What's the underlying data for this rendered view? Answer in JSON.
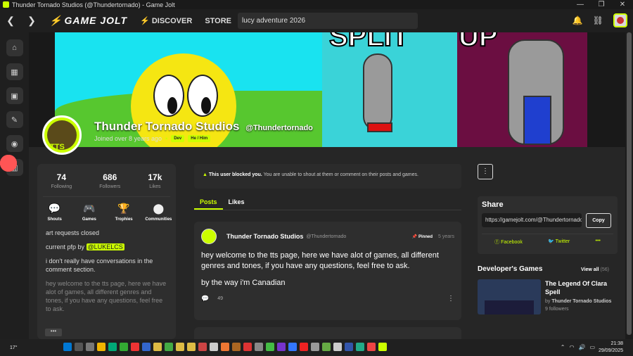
{
  "window": {
    "title": "Thunder Tornado Studios (@Thundertornado) - Game Jolt",
    "controls": [
      "—",
      "❐",
      "✕"
    ]
  },
  "navbar": {
    "back": "❮",
    "forward": "❯",
    "logo": "GAME JOLT",
    "discover": "DISCOVER",
    "store": "STORE",
    "more": "⋮",
    "search_value": "lucy adventure 2026"
  },
  "profile": {
    "name": "Thunder Tornado Studios",
    "handle": "@Thundertornado",
    "joined": "Joined over 8 years ago",
    "tag_dev": "Dev",
    "tag_pronouns": "He / Him",
    "avatar_text": "TTS",
    "stats": [
      {
        "value": "74",
        "label": "Following"
      },
      {
        "value": "686",
        "label": "Followers"
      },
      {
        "value": "17k",
        "label": "Likes"
      }
    ],
    "actions": [
      {
        "label": "Shouts",
        "icon": "💬"
      },
      {
        "label": "Games",
        "icon": "🎮"
      },
      {
        "label": "Trophies",
        "icon": "🏆"
      },
      {
        "label": "Communities",
        "icon": "⬤"
      }
    ],
    "bio": {
      "line1": "art requests closed",
      "line2_prefix": "current pfp by",
      "mention": "@LUKELCS",
      "line3": "i don't really have conversations in the comment section.",
      "line4": "hey welcome to the tts page, here we have alot of games, all different genres and tones, if you have any questions, feel free to ask.",
      "more": "•••"
    }
  },
  "blocked": {
    "bold": "This user blocked you.",
    "text": "You are unable to shout at them or comment on their posts and games."
  },
  "tabs": [
    {
      "label": "Posts"
    },
    {
      "label": "Likes"
    }
  ],
  "post": {
    "author": "Thunder Tornado Studios",
    "handle": "@Thundertornado",
    "pinned": "Pinned",
    "time": "5 years",
    "paragraph1": "hey welcome to the tts page, here we have alot of games, all different genres and tones, if you have any questions, feel free to ask.",
    "paragraph2": "by the way i'm Canadian",
    "comments": "49"
  },
  "share": {
    "title": "Share",
    "url": "https://gamejolt.com/@Thundertornado",
    "copy": "Copy",
    "facebook": "Facebook",
    "twitter": "Twitter",
    "more": "•••"
  },
  "dev_games": {
    "title": "Developer's Games",
    "view_all": "View all",
    "count": "(56)",
    "game_title": "The Legend Of Clara Spell",
    "by": "by",
    "by_name": "Thunder Tornado Studios",
    "followers": "9 followers"
  },
  "taskbar": {
    "temp": "17°",
    "time": "21:38",
    "date": "29/09/2025"
  },
  "colors": {
    "accent": "#ccff00",
    "background": "#262626"
  }
}
